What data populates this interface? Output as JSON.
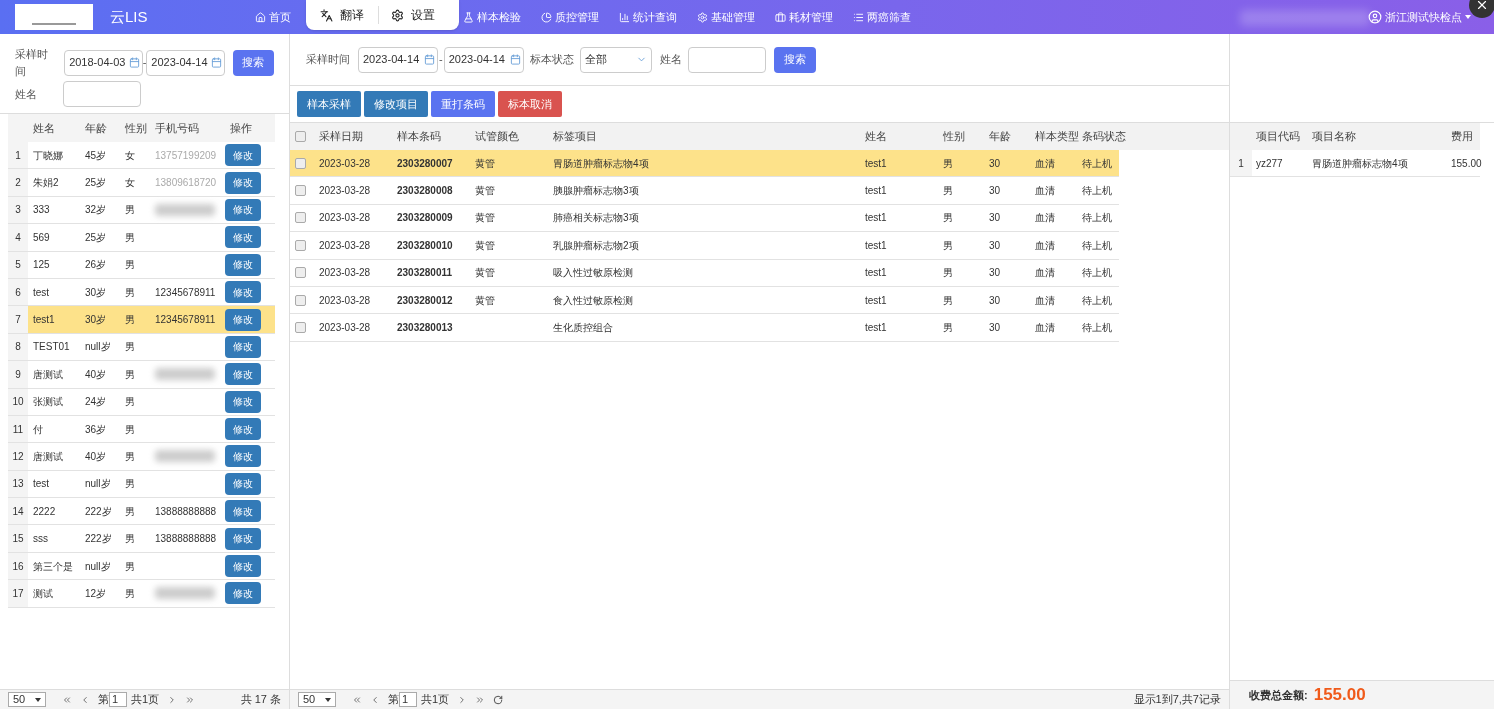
{
  "header": {
    "app_title": "云LIS",
    "nav": [
      {
        "label": "首页"
      },
      {
        "label": "样本检验"
      },
      {
        "label": "质控管理"
      },
      {
        "label": "统计查询"
      },
      {
        "label": "基础管理"
      },
      {
        "label": "耗材管理"
      },
      {
        "label": "两癌筛查"
      }
    ],
    "translate_popup": [
      "翻译",
      "设置"
    ],
    "user": "浙江测试快检点"
  },
  "patients": {
    "filter": {
      "time_label": "采样时间",
      "start": "2018-04-03",
      "sep": "-",
      "end": "2023-04-14",
      "search": "搜索",
      "name_label": "姓名"
    },
    "columns": [
      "姓名",
      "年龄",
      "性别",
      "手机号码",
      "操作"
    ],
    "rows": [
      {
        "index": "1",
        "name": "丁晓娜",
        "age": "45岁",
        "sex": "女",
        "phone": "13757199209",
        "phone_blurred": false,
        "action": "修改",
        "selected": false
      },
      {
        "index": "2",
        "name": "朱娟2",
        "age": "25岁",
        "sex": "女",
        "phone": "13809618720",
        "phone_blurred": false,
        "action": "修改",
        "selected": false
      },
      {
        "index": "3",
        "name": "333",
        "age": "32岁",
        "sex": "男",
        "phone_blurred": true,
        "action": "修改",
        "selected": false
      },
      {
        "index": "4",
        "name": "569",
        "age": "25岁",
        "sex": "男",
        "phone_blurred": false,
        "action": "修改",
        "selected": false
      },
      {
        "index": "5",
        "name": "125",
        "age": "26岁",
        "sex": "男",
        "phone_blurred": false,
        "action": "修改",
        "selected": false
      },
      {
        "index": "6",
        "name": "test",
        "age": "30岁",
        "sex": "男",
        "phone": "12345678911",
        "phone_blurred": false,
        "action": "修改",
        "selected": false
      },
      {
        "index": "7",
        "name": "test1",
        "age": "30岁",
        "sex": "男",
        "phone": "12345678911",
        "phone_blurred": false,
        "action": "修改",
        "selected": true
      },
      {
        "index": "8",
        "name": "TEST01",
        "age": "null岁",
        "sex": "男",
        "phone_blurred": false,
        "action": "修改",
        "selected": false
      },
      {
        "index": "9",
        "name": "唐测试",
        "age": "40岁",
        "sex": "男",
        "phone_blurred": true,
        "action": "修改",
        "selected": false
      },
      {
        "index": "10",
        "name": "张测试",
        "age": "24岁",
        "sex": "男",
        "phone_blurred": false,
        "action": "修改",
        "selected": false
      },
      {
        "index": "11",
        "name": "付",
        "age": "36岁",
        "sex": "男",
        "phone_blurred": false,
        "action": "修改",
        "selected": false
      },
      {
        "index": "12",
        "name": "唐测试",
        "age": "40岁",
        "sex": "男",
        "phone_blurred": true,
        "action": "修改",
        "selected": false
      },
      {
        "index": "13",
        "name": "test",
        "age": "null岁",
        "sex": "男",
        "phone_blurred": false,
        "action": "修改",
        "selected": false
      },
      {
        "index": "14",
        "name": "2222",
        "age": "222岁",
        "sex": "男",
        "phone": "13888888888",
        "phone_blurred": false,
        "action": "修改",
        "selected": false
      },
      {
        "index": "15",
        "name": "sss",
        "age": "222岁",
        "sex": "男",
        "phone": "13888888888",
        "phone_blurred": false,
        "action": "修改",
        "selected": false
      },
      {
        "index": "16",
        "name": "第三个是",
        "age": "null岁",
        "sex": "男",
        "phone_blurred": false,
        "action": "修改",
        "selected": false
      },
      {
        "index": "17",
        "name": "测试",
        "age": "12岁",
        "sex": "男",
        "phone_blurred": true,
        "action": "修改",
        "selected": false
      }
    ],
    "pager": {
      "page_size": "50",
      "page_prefix": "第",
      "page": "1",
      "pages": "共1页",
      "total": "共 17 条"
    }
  },
  "samples": {
    "filter": {
      "time_label": "采样时间",
      "start": "2023-04-14",
      "sep": "-",
      "end": "2023-04-14",
      "status_label": "标本状态",
      "status": "全部",
      "name_label": "姓名",
      "search": "搜索"
    },
    "buttons": [
      {
        "label": "样本采样",
        "color": "#337ab7"
      },
      {
        "label": "修改项目",
        "color": "#337ab7"
      },
      {
        "label": "重打条码",
        "color": "#5a73f0"
      },
      {
        "label": "标本取消",
        "color": "#d9534f"
      }
    ],
    "all_checked": false,
    "columns": [
      "采样日期",
      "样本条码",
      "试管颜色",
      "标签项目",
      "姓名",
      "性别",
      "年龄",
      "样本类型",
      "条码状态"
    ],
    "rows": [
      {
        "checked": false,
        "selected": true,
        "date": "2023-03-28",
        "barcode": "2303280007",
        "tube": "黄管",
        "item": "胃肠道肿瘤标志物4项",
        "name": "test1",
        "sex": "男",
        "age": "30",
        "type": "血清",
        "status": "待上机"
      },
      {
        "checked": false,
        "selected": false,
        "date": "2023-03-28",
        "barcode": "2303280008",
        "tube": "黄管",
        "item": "胰腺肿瘤标志物3项",
        "name": "test1",
        "sex": "男",
        "age": "30",
        "type": "血清",
        "status": "待上机"
      },
      {
        "checked": false,
        "selected": false,
        "date": "2023-03-28",
        "barcode": "2303280009",
        "tube": "黄管",
        "item": "肺癌相关标志物3项",
        "name": "test1",
        "sex": "男",
        "age": "30",
        "type": "血清",
        "status": "待上机"
      },
      {
        "checked": false,
        "selected": false,
        "date": "2023-03-28",
        "barcode": "2303280010",
        "tube": "黄管",
        "item": "乳腺肿瘤标志物2项",
        "name": "test1",
        "sex": "男",
        "age": "30",
        "type": "血清",
        "status": "待上机"
      },
      {
        "checked": false,
        "selected": false,
        "date": "2023-03-28",
        "barcode": "2303280011",
        "tube": "黄管",
        "item": "吸入性过敏原检测",
        "name": "test1",
        "sex": "男",
        "age": "30",
        "type": "血清",
        "status": "待上机"
      },
      {
        "checked": false,
        "selected": false,
        "date": "2023-03-28",
        "barcode": "2303280012",
        "tube": "黄管",
        "item": "食入性过敏原检测",
        "name": "test1",
        "sex": "男",
        "age": "30",
        "type": "血清",
        "status": "待上机"
      },
      {
        "checked": false,
        "selected": false,
        "date": "2023-03-28",
        "barcode": "2303280013",
        "item": "生化质控组合",
        "name": "test1",
        "sex": "男",
        "age": "30",
        "type": "血清",
        "status": "待上机"
      }
    ],
    "pager": {
      "page_size": "50",
      "page_prefix": "第",
      "page": "1",
      "pages": "共1页",
      "info": "显示1到7,共7记录"
    }
  },
  "items": {
    "columns": [
      "项目代码",
      "项目名称",
      "费用"
    ],
    "rows": [
      {
        "index": "1",
        "code": "yz277",
        "name": "胃肠道肿瘤标志物4项",
        "fee": "155.00"
      }
    ],
    "total_label": "收费总金额:",
    "total": "155.00"
  }
}
